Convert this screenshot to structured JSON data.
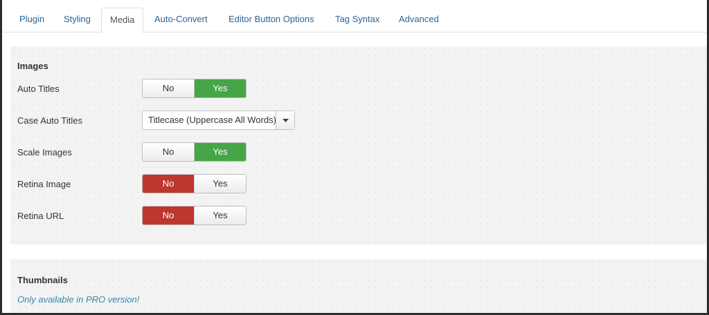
{
  "tabs": [
    {
      "label": "Plugin"
    },
    {
      "label": "Styling"
    },
    {
      "label": "Media"
    },
    {
      "label": "Auto-Convert"
    },
    {
      "label": "Editor Button Options"
    },
    {
      "label": "Tag Syntax"
    },
    {
      "label": "Advanced"
    }
  ],
  "active_tab": "Media",
  "images": {
    "title": "Images",
    "auto_titles": {
      "label": "Auto Titles",
      "no": "No",
      "yes": "Yes",
      "selected": "Yes"
    },
    "case_auto_titles": {
      "label": "Case Auto Titles",
      "value": "Titlecase (Uppercase All Words)"
    },
    "scale_images": {
      "label": "Scale Images",
      "no": "No",
      "yes": "Yes",
      "selected": "Yes"
    },
    "retina_image": {
      "label": "Retina Image",
      "no": "No",
      "yes": "Yes",
      "selected": "No"
    },
    "retina_url": {
      "label": "Retina URL",
      "no": "No",
      "yes": "Yes",
      "selected": "No"
    }
  },
  "thumbnails": {
    "title": "Thumbnails",
    "note": "Only available in PRO version!"
  },
  "colors": {
    "yes_active": "#46a546",
    "no_active": "#bd362f",
    "link": "#2a6496"
  }
}
